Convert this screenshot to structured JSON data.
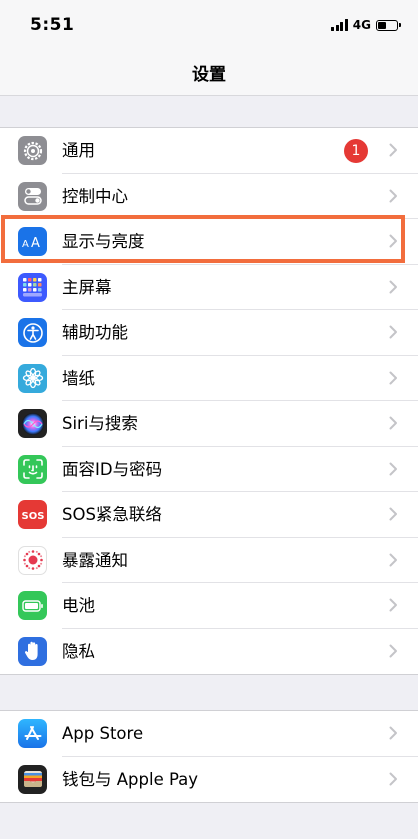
{
  "status": {
    "time": "5:51",
    "network": "4G",
    "battery_level": 0.45
  },
  "nav": {
    "title": "设置"
  },
  "groups": [
    {
      "items": [
        {
          "label": "通用",
          "icon": "gear-icon",
          "color": "#8e8e93",
          "badge": "1"
        },
        {
          "label": "控制中心",
          "icon": "toggles-icon",
          "color": "#8e8e93"
        },
        {
          "label": "显示与亮度",
          "icon": "text-size-icon",
          "color": "#1a73e8",
          "highlighted": true
        },
        {
          "label": "主屏幕",
          "icon": "app-grid-icon",
          "color": "#3d5afe"
        },
        {
          "label": "辅助功能",
          "icon": "accessibility-icon",
          "color": "#1a73e8"
        },
        {
          "label": "墙纸",
          "icon": "flower-icon",
          "color": "#35aadc"
        },
        {
          "label": "Siri与搜索",
          "icon": "siri-icon",
          "color": "#222222"
        },
        {
          "label": "面容ID与密码",
          "icon": "face-id-icon",
          "color": "#34c759"
        },
        {
          "label": "SOS紧急联络",
          "icon": "sos-icon",
          "color": "#e53935"
        },
        {
          "label": "暴露通知",
          "icon": "exposure-icon",
          "color": "#ffffff"
        },
        {
          "label": "电池",
          "icon": "battery-icon",
          "color": "#34c759"
        },
        {
          "label": "隐私",
          "icon": "hand-icon",
          "color": "#2f6fe0"
        }
      ]
    },
    {
      "items": [
        {
          "label": "App Store",
          "icon": "app-store-icon",
          "color": "#1e90ff"
        },
        {
          "label": "钱包与 Apple Pay",
          "icon": "wallet-icon",
          "color": "#222222"
        }
      ]
    }
  ]
}
